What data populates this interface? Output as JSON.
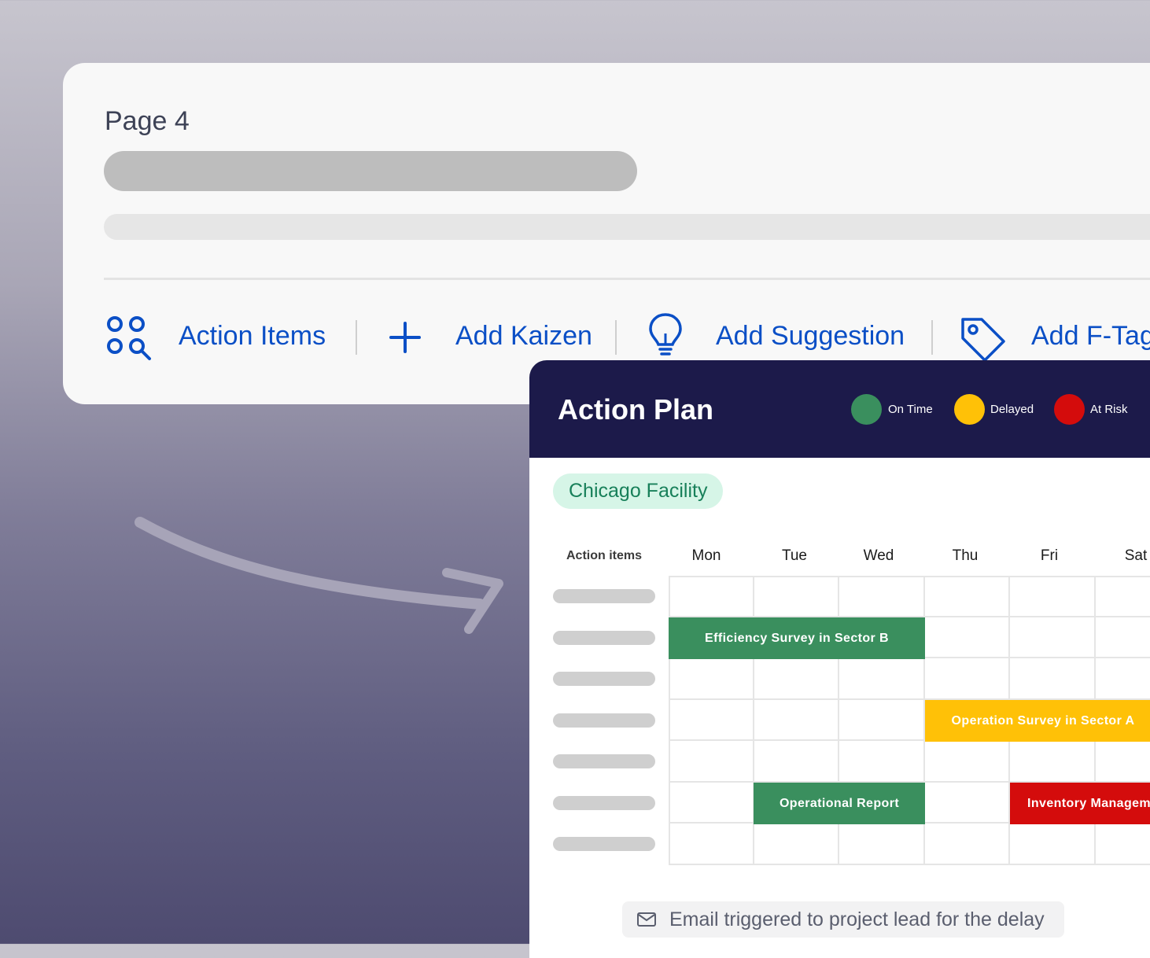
{
  "page": {
    "title": "Page 4"
  },
  "toolbar": {
    "action_items_label": "Action Items",
    "add_kaizen_label": "Add Kaizen",
    "add_suggestion_label": "Add Suggestion",
    "add_ftag_label": "Add F-Tag",
    "icons": [
      "action-items-icon",
      "plus-icon",
      "lightbulb-icon",
      "tag-icon"
    ],
    "accent_color": "#0b4fc6"
  },
  "plan": {
    "title": "Action Plan",
    "legend": [
      {
        "label": "On Time",
        "color": "#3a8f5e"
      },
      {
        "label": "Delayed",
        "color": "#ffc107"
      },
      {
        "label": "At Risk",
        "color": "#d40c0c"
      }
    ],
    "facility": "Chicago Facility",
    "action_items_header": "Action items",
    "days": [
      "Mon",
      "Tue",
      "Wed",
      "Thu",
      "Fri",
      "Sat"
    ],
    "tasks": [
      {
        "label": "Efficiency Survey in Sector B",
        "status": "On Time"
      },
      {
        "label": "Operation Survey in Sector A",
        "status": "Delayed"
      },
      {
        "label": "Operational Report",
        "status": "On Time"
      },
      {
        "label": "Inventory Management",
        "status": "At Risk"
      }
    ],
    "email_note": "Email triggered to project lead for the delay"
  }
}
